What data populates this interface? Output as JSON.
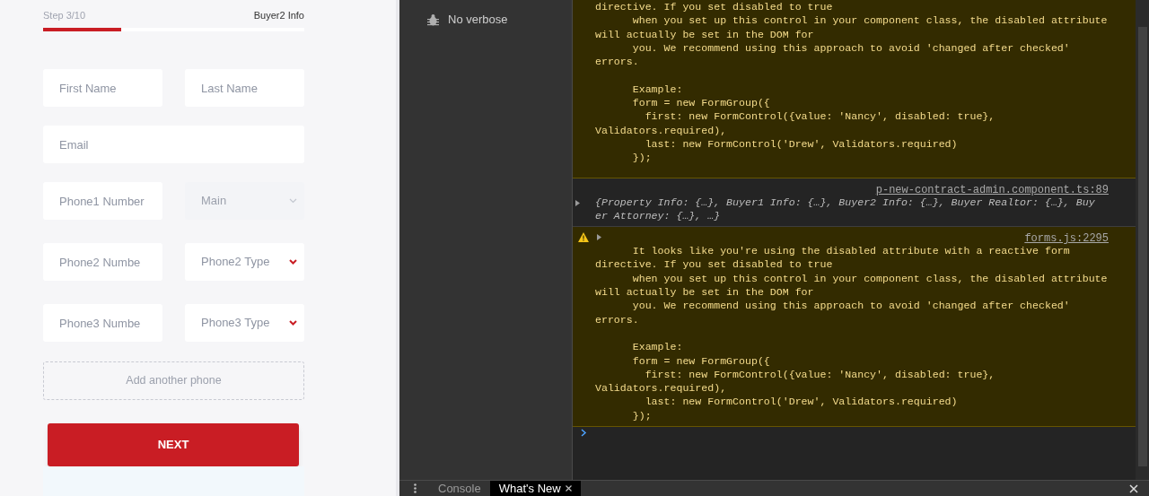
{
  "form": {
    "step": {
      "label": "Step 3/10",
      "title": "Buyer2 Info",
      "level": 0.3
    },
    "rows": [
      [
        {
          "kind": "input",
          "placeholder": "First Name"
        },
        {
          "kind": "input",
          "placeholder": "Last Name"
        }
      ],
      [
        {
          "kind": "input",
          "placeholder": "Email"
        }
      ],
      [
        {
          "kind": "input",
          "placeholder": "Phone1 Number"
        },
        {
          "kind": "select",
          "value": "Main",
          "disabled": true
        }
      ],
      [
        {
          "kind": "input",
          "placeholder": "Phone2 Numbe"
        },
        {
          "kind": "select",
          "value": "Phone2 Type",
          "disabled": false
        }
      ],
      [
        {
          "kind": "input",
          "placeholder": "Phone3 Numbe"
        },
        {
          "kind": "select",
          "value": "Phone3 Type",
          "disabled": false
        }
      ]
    ],
    "add_phone": "Add another phone",
    "next_button": "NEXT"
  },
  "devtools": {
    "sidebar": {
      "items": [
        {
          "label": "No verbose"
        }
      ]
    },
    "messages": [
      {
        "kind": "warning",
        "text": "directive. If you set disabled to true\n      when you set up this control in your component class, the disabled attribute\nwill actually be set in the DOM for\n      you. We recommend using this approach to avoid 'changed after checked'\nerrors.\n\n      Example:\n      form = new FormGroup({\n        first: new FormControl({value: 'Nancy', disabled: true},\nValidators.required),\n        last: new FormControl('Drew', Validators.required)\n      });"
      },
      {
        "kind": "log",
        "source": "p-new-contract-admin.component.ts:89",
        "text": "{Property Info: {…}, Buyer1 Info: {…}, Buyer2 Info: {…}, Buyer Realtor: {…}, Buy\ner Attorney: {…}, …}"
      },
      {
        "kind": "warning",
        "source": "forms.js:2295",
        "text": "      It looks like you're using the disabled attribute with a reactive form\ndirective. If you set disabled to true\n      when you set up this control in your component class, the disabled attribute\nwill actually be set in the DOM for\n      you. We recommend using this approach to avoid 'changed after checked'\nerrors.\n\n      Example:\n      form = new FormGroup({\n        first: new FormControl({value: 'Nancy', disabled: true},\nValidators.required),\n        last: new FormControl('Drew', Validators.required)\n      });"
      }
    ],
    "drawer_tabs": [
      {
        "label": "Console",
        "selected": false
      },
      {
        "label": "What's New",
        "selected": true,
        "closable": true
      }
    ]
  }
}
